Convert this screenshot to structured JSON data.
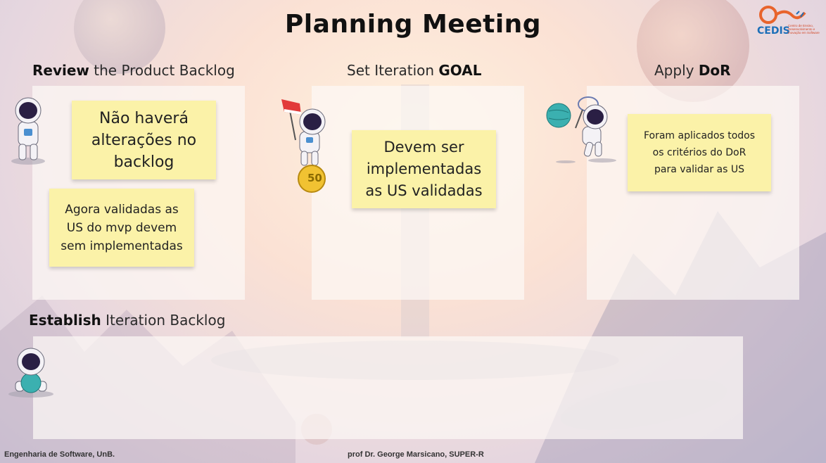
{
  "title": "Planning Meeting",
  "logo": {
    "name": "CEDIS",
    "subtitle": "Centro de Ensino, Desenvolvimento e Inovação em Software"
  },
  "sections": {
    "review": {
      "bold": "Review",
      "rest": " the Product Backlog"
    },
    "goal": {
      "rest": "Set Iteration ",
      "bold": "GOAL"
    },
    "dor": {
      "rest": "Apply ",
      "bold": "DoR"
    },
    "establish": {
      "bold": "Establish",
      "rest": " Iteration Backlog"
    }
  },
  "notes": {
    "review_1": [
      "Não haverá",
      "alterações no",
      "backlog"
    ],
    "review_2": [
      "Agora validadas as",
      "US do mvp devem",
      "sem implementadas"
    ],
    "goal_1": [
      "Devem ser",
      "implementadas",
      "as US validadas"
    ],
    "dor_1": [
      "Foram aplicados todos",
      "os critérios do DoR",
      "para validar as US"
    ]
  },
  "coin_text": "50",
  "footer": {
    "left": "Engenharia de Software, UnB.",
    "center": "prof Dr. George Marsicano, SUPER-R"
  },
  "colors": {
    "sticky": "#fbf2a8",
    "logo_blue": "#1d6fb8",
    "logo_orange": "#e8642c"
  }
}
